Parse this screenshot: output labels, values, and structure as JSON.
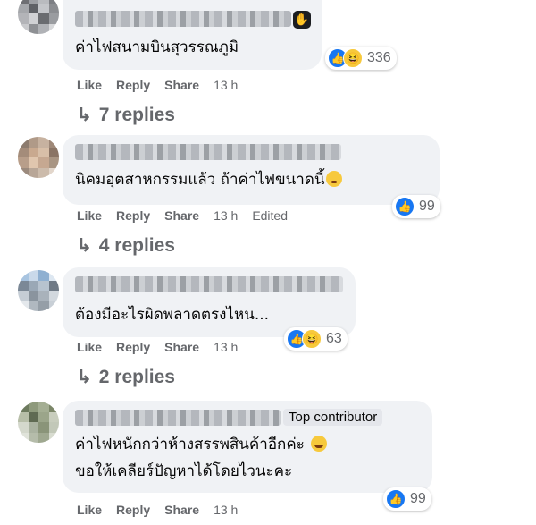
{
  "comments": [
    {
      "text_lines": [
        "ค่าไฟสนามบินสุวรรณภูมิ"
      ],
      "actions": {
        "like": "Like",
        "reply": "Reply",
        "share": "Share",
        "time": "13 h"
      },
      "reaction_count": "336",
      "reactions": [
        "like-icon",
        "haha-icon"
      ],
      "replies": "7 replies"
    },
    {
      "text_lines": [
        "นิคมอุตสาหกรรมแล้ว ถ้าค่าไฟขนาดนี้"
      ],
      "actions": {
        "like": "Like",
        "reply": "Reply",
        "share": "Share",
        "time": "13 h",
        "edited": "Edited"
      },
      "reaction_count": "99",
      "reactions": [
        "like-icon"
      ],
      "replies": "4 replies"
    },
    {
      "text_lines": [
        "ต้องมีอะไรผิดพลาดตรงไหน..."
      ],
      "actions": {
        "like": "Like",
        "reply": "Reply",
        "share": "Share",
        "time": "13 h"
      },
      "reaction_count": "63",
      "reactions": [
        "like-icon",
        "haha-icon"
      ],
      "replies": "2 replies"
    },
    {
      "badge": "Top contributor",
      "text_lines": [
        "ค่าไฟหนักกว่าห้างสรรพสินค้าอีกค่ะ",
        "ขอให้เคลียร์ปัญหาได้โดยไวนะคะ"
      ],
      "actions": {
        "like": "Like",
        "reply": "Reply",
        "share": "Share",
        "time": "13 h"
      },
      "reaction_count": "99",
      "reactions": [
        "like-icon"
      ]
    }
  ],
  "colors": {
    "bubble": "#f0f2f5",
    "meta": "#65676b",
    "like": "#1877f2",
    "haha": "#f7c93c"
  }
}
